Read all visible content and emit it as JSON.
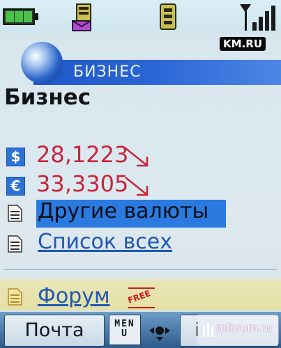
{
  "status_bar": {
    "battery_level": 0.75,
    "signal_level": 4,
    "icons": [
      "battery-icon",
      "message-icon",
      "sim-icon",
      "signal-icon"
    ]
  },
  "header": {
    "brand_badge": "KM.RU",
    "banner_title": "БИЗНЕС"
  },
  "main": {
    "page_title": "Бизнес",
    "rates": [
      {
        "currency_symbol": "$",
        "value": "28,1223",
        "trend": "down"
      },
      {
        "currency_symbol": "€",
        "value": "33,3305",
        "trend": "down"
      }
    ],
    "links": [
      {
        "label": "Другие валюты",
        "selected": true
      },
      {
        "label": "Список всех",
        "selected": false
      }
    ],
    "forum": {
      "label": "Форум",
      "badge": "FREE"
    }
  },
  "softkeys": {
    "left_label": "Почта",
    "menu_label": "MENU",
    "right_label": "i"
  },
  "watermark": {
    "text": "mforum.ru"
  },
  "colors": {
    "accent": "#2a7adf",
    "rate_red": "#c6253a",
    "link_blue": "#1f57b6",
    "banner_blue": "#1e56c6"
  }
}
